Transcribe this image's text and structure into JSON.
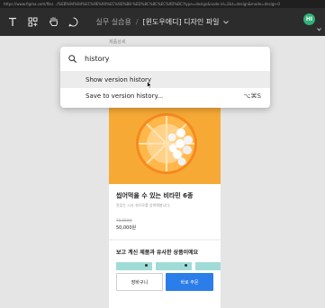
{
  "browser": {
    "url": "https://www.figma.com/file/…/%EB%94%94%EC%9E%90%EC%9D%B8-%ED%8C%8C%EC%9D%BC?type=design&node-id=2&t=design&mode=design-0"
  },
  "toolbar": {
    "project": "실무 실습용",
    "separator": "/",
    "file_name": "[윈도우에디] 디자인 파일",
    "avatar_initials": "HI"
  },
  "canvas": {
    "frame_label": "제품상세",
    "product": {
      "title": "씹어먹을 수 있는 비타민 6종",
      "description": "맛있는 시사 쉬으로를 섭취해봅니다.",
      "original_price": "70,000원",
      "price": "50,000원"
    },
    "similar_title": "보고 계신 제품과 유사한 상품이에요",
    "cart_button": "장바구니",
    "buy_button": "바로 주문"
  },
  "command_palette": {
    "query": "history",
    "items": [
      {
        "label": "Show version history",
        "shortcut": ""
      },
      {
        "label": "Save to version history...",
        "shortcut": "⌥⌘S"
      }
    ]
  },
  "colors": {
    "toolbar_bg": "#2c2c2c",
    "canvas_bg": "#e5e5e5",
    "hero_orange": "#f7a936",
    "buy_button_blue": "#2b7de9",
    "avatar_green": "#2fb17a"
  }
}
